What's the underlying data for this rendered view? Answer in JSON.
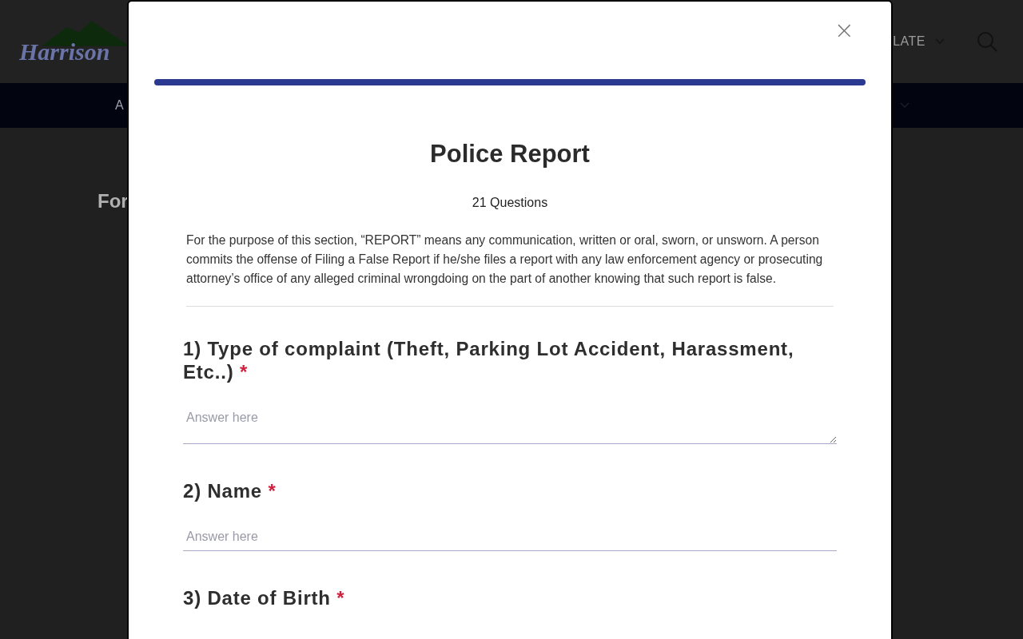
{
  "site": {
    "logo_text": "Harrison",
    "translate": "LATE",
    "nav_item": "A",
    "page_heading": "For"
  },
  "modal": {
    "title": "Police Report",
    "question_count": "21 Questions",
    "close": "×",
    "progress": {
      "level": 1
    },
    "description": "For the purpose of this section, “REPORT” means any communication, written or oral, sworn, or unsworn. A person commits the offense of Filing a False Report if he/she files a report with any law enforcement agency or prosecuting attorney’s office of any alleged criminal wrongdoing on the part of another knowing that such report is false.",
    "questions": [
      {
        "label": "1) Type of complaint (Theft, Parking Lot Accident, Harassment, Etc..)",
        "required_mark": "*",
        "kind": "textarea",
        "placeholder": "Answer here"
      },
      {
        "label": "2) Name",
        "required_mark": "*",
        "kind": "input",
        "placeholder": "Answer here"
      },
      {
        "label": "3) Date of Birth",
        "required_mark": "*"
      }
    ]
  }
}
